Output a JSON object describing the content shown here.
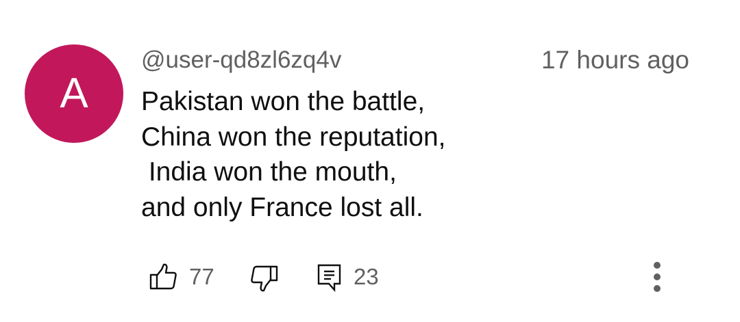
{
  "comment": {
    "avatar": {
      "initial": "A",
      "color": "#c2185b"
    },
    "author": "@user-qd8zl6zq4v",
    "timestamp": "17 hours ago",
    "lines": [
      "Pakistan won the battle,",
      "China won the reputation,",
      " India won the mouth,",
      "and only France lost all."
    ],
    "actions": {
      "like": {
        "icon": "thumbs-up-icon",
        "count": "77"
      },
      "dislike": {
        "icon": "thumbs-down-icon"
      },
      "reply": {
        "icon": "comment-icon",
        "count": "23"
      },
      "more": {
        "icon": "more-vertical-icon"
      }
    }
  }
}
